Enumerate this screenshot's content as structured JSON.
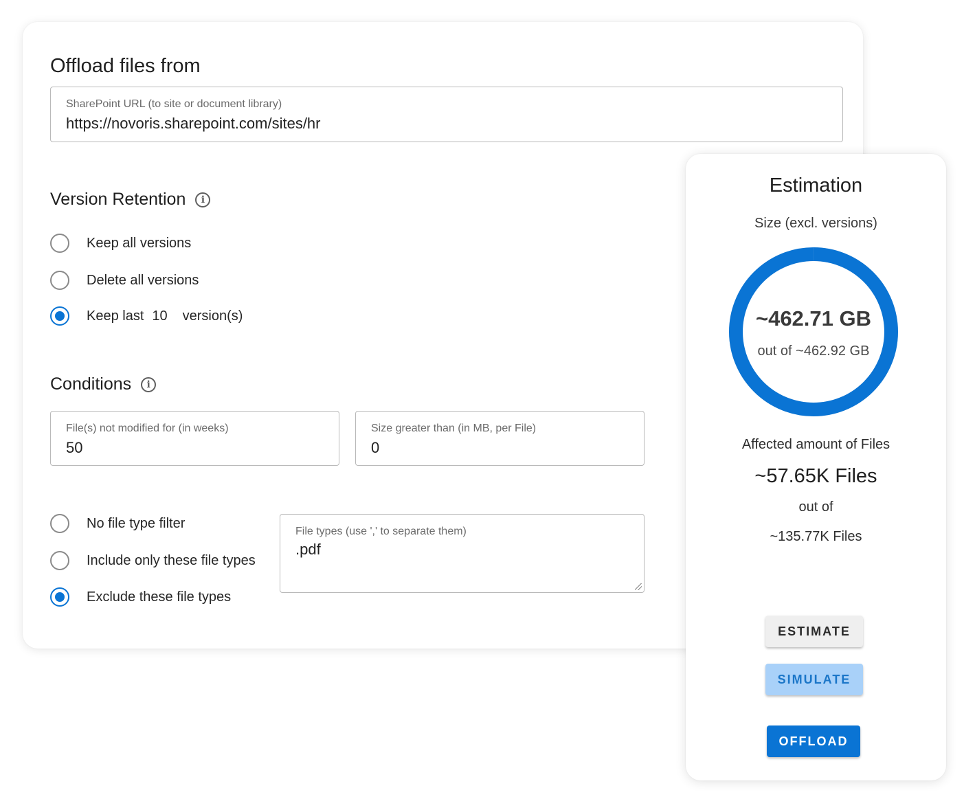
{
  "offload": {
    "title": "Offload files from",
    "url_field": {
      "label": "SharePoint URL (to site or document library)",
      "value": "https://novoris.sharepoint.com/sites/hr"
    }
  },
  "version_retention": {
    "title": "Version Retention",
    "options": [
      {
        "label": "Keep all versions",
        "selected": false
      },
      {
        "label": "Delete all versions",
        "selected": false
      },
      {
        "label_prefix": "Keep last",
        "count": "10",
        "label_suffix": "version(s)",
        "selected": true
      }
    ]
  },
  "conditions": {
    "title": "Conditions",
    "not_modified": {
      "label": "File(s) not modified for (in weeks)",
      "value": "50"
    },
    "size_greater": {
      "label": "Size greater than (in MB, per File)",
      "value": "0"
    },
    "file_type_filters": [
      {
        "label": "No file type filter",
        "selected": false
      },
      {
        "label": "Include only these file types",
        "selected": false
      },
      {
        "label": "Exclude these file types",
        "selected": true
      }
    ],
    "file_types": {
      "label": "File types (use ',' to separate them)",
      "value": ".pdf"
    }
  },
  "estimation": {
    "title": "Estimation",
    "size_label": "Size (excl. versions)",
    "size_value": "~462.71 GB",
    "size_total": "out of ~462.92 GB",
    "size_fraction": 0.9995,
    "files_label": "Affected amount of Files",
    "files_value": "~57.65K Files",
    "files_out_of": "out of",
    "files_total": "~135.77K Files",
    "buttons": {
      "estimate": "ESTIMATE",
      "simulate": "SIMULATE",
      "offload": "OFFLOAD"
    }
  },
  "colors": {
    "accent": "#0a74d4",
    "simulate_bg": "#a9d1f9",
    "estimate_bg": "#efefef"
  }
}
